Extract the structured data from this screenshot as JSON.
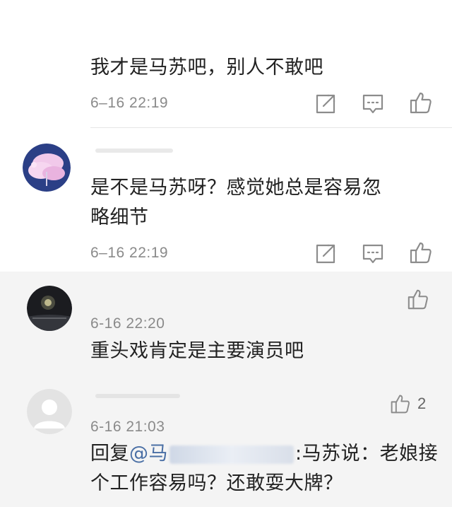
{
  "comments": [
    {
      "text": "我才是马苏吧，别人不敢吧",
      "time": "6–16 22:19",
      "icons": [
        "share-icon",
        "comment-icon",
        "like-icon"
      ]
    },
    {
      "text_line1": "是不是马苏呀？感觉她总是容易忽",
      "text_line2": "略细节",
      "time": "6–16 22:19",
      "icons": [
        "share-icon",
        "comment-icon",
        "like-icon"
      ]
    }
  ],
  "replies": [
    {
      "time": "6-16 22:20",
      "text": "重头戏肯定是主要演员吧"
    },
    {
      "time": "6-16 21:03",
      "likes": "2",
      "prefix": "回复",
      "mention": "@",
      "mention_partial": "马",
      "text_rest": ":马苏说：老娘接",
      "text_line2": "个工作容易吗？还敢耍大牌？"
    }
  ],
  "colors": {
    "text": "#222222",
    "time": "#8a8a8a",
    "icon": "#8c8c8c",
    "gray_bg": "#f4f4f4",
    "mention": "#4a6fa5"
  }
}
